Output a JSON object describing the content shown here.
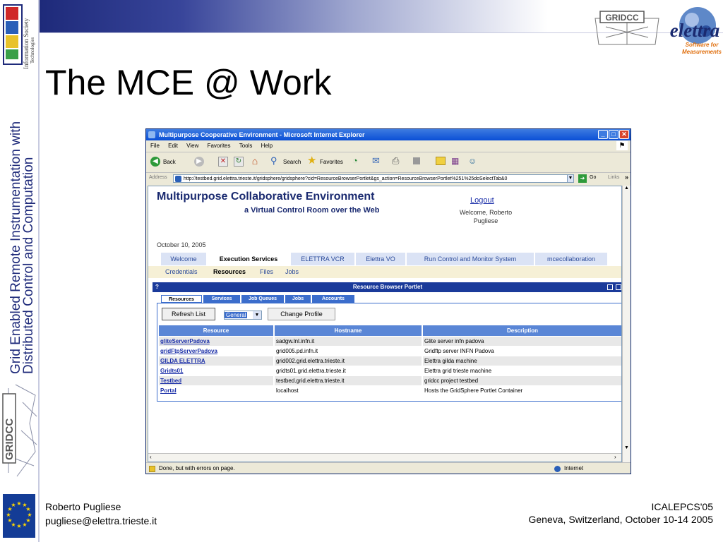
{
  "slide": {
    "title": "The MCE @ Work",
    "vertical_title_line1": "Grid Enabled Remote Instrumentation with",
    "vertical_title_line2": "Distributed Control and Computation",
    "ist_label_line1": "Information Society",
    "ist_label_line2": "Technologies",
    "gridcc_logo_text": "GRIDCC",
    "elettra_logo_text": "elettra",
    "elettra_tagline_line1": "Software for",
    "elettra_tagline_line2": "Measurements",
    "footer_left_line1": "Roberto Pugliese",
    "footer_left_line2": "pugliese@elettra.trieste.it",
    "footer_right_line1": "ICALEPCS'05",
    "footer_right_line2": "Geneva, Switzerland, October 10-14 2005"
  },
  "browser": {
    "title": "Multipurpose Cooperative Environment - Microsoft Internet Explorer",
    "menu": [
      "File",
      "Edit",
      "View",
      "Favorites",
      "Tools",
      "Help"
    ],
    "toolbar": {
      "back": "Back",
      "search": "Search",
      "favorites": "Favorites"
    },
    "address_label": "Address",
    "address": "http://testbed.grid.elettra.trieste.it/gridsphere/gridsphere?cid=ResourceBrowserPortlet&gs_action=ResourceBrowserPortlet%251%25doSelectTab&0",
    "go_label": "Go",
    "links_label": "Links",
    "status_text": "Done, but with errors on page.",
    "zone_text": "Internet"
  },
  "page": {
    "heading": "Multipurpose Collaborative Environment",
    "subheading": "a Virtual Control Room over the Web",
    "logout": "Logout",
    "welcome_line1": "Welcome, Roberto",
    "welcome_line2": "Pugliese",
    "date": "October 10, 2005",
    "tabs": [
      "Welcome",
      "Execution Services",
      "ELETTRA VCR",
      "Elettra VO",
      "Run Control and Monitor System",
      "mcecollaboration"
    ],
    "active_tab": "Execution Services",
    "subtabs": [
      "Credentials",
      "Resources",
      "Files",
      "Jobs"
    ],
    "active_subtab": "Resources"
  },
  "portlet": {
    "help_mark": "?",
    "title": "Resource Browser Portlet",
    "tabs": [
      "Resources",
      "Services",
      "Job Queues",
      "Jobs",
      "Accounts"
    ],
    "active_tab": "Resources",
    "refresh_button": "Refresh List",
    "select_value": "General",
    "change_profile_button": "Change Profile",
    "columns": [
      "Resource",
      "Hostname",
      "Description"
    ],
    "rows": [
      {
        "resource": "gliteServerPadova",
        "hostname": "sadgw.lnl.infn.it",
        "description": "Glite server infn padova"
      },
      {
        "resource": "gridFtpServerPadova",
        "hostname": "grid005.pd.infn.it",
        "description": "Gridftp server INFN Padova"
      },
      {
        "resource": "GILDA ELETTRA",
        "hostname": "grid002.grid.elettra.trieste.it",
        "description": "Elettra gilda machine"
      },
      {
        "resource": "Gridts01",
        "hostname": "gridts01.grid.elettra.trieste.it",
        "description": "Elettra grid trieste machine"
      },
      {
        "resource": "Testbed",
        "hostname": "testbed.grid.elettra.trieste.it",
        "description": "gridcc project testbed"
      },
      {
        "resource": "Portal",
        "hostname": "localhost",
        "description": "Hosts the GridSphere Portlet Container"
      }
    ]
  },
  "colors": {
    "banner": "#1e2a7a",
    "ie_titlebar": "#0a4fd6",
    "table_header": "#5a86d6",
    "link": "#1a2ea8"
  }
}
